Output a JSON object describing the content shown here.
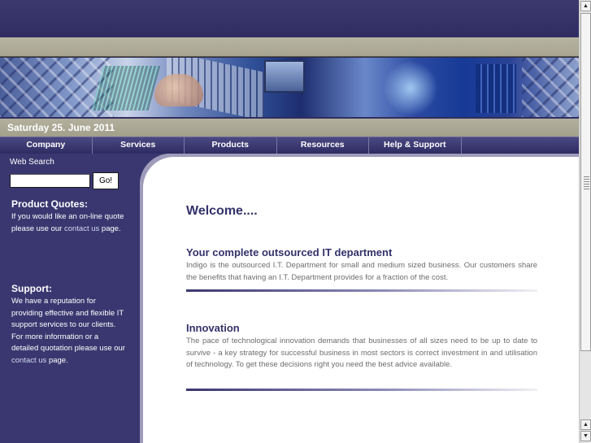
{
  "header": {
    "date": "Saturday 25. June 2011"
  },
  "nav": {
    "items": [
      "Company",
      "Services",
      "Products",
      "Resources",
      "Help & Support"
    ]
  },
  "sidebar": {
    "search_label": "Web Search",
    "search_value": "",
    "go_label": "Go!",
    "quotes": {
      "title": "Product Quotes:",
      "text_before": "If you would like an on-line quote please use our ",
      "link": "contact us",
      "text_after": " page."
    },
    "support": {
      "title": "Support:",
      "text_before": "We have a reputation for providing effective and flexible IT support services to our clients. For more information or a detailed quotation please use our ",
      "link": "contact us",
      "text_after": " page."
    }
  },
  "main": {
    "welcome": "Welcome....",
    "sections": [
      {
        "title": "Your complete outsourced IT department",
        "body": "Indigo is the outsourced I.T. Department for small and medium sized business. Our customers share the benefits that having an I.T. Department provides for a fraction of the cost."
      },
      {
        "title": "Innovation",
        "body": "The pace of technological innovation demands that businesses of all sizes need to be up to date to survive - a key strategy for successful business in most sectors is correct investment in and utilisation of technology. To get these decisions right you need the best advice available."
      }
    ]
  },
  "scrollbar": {
    "up_icon": "up-arrow-icon",
    "down_icon": "down-arrow-icon"
  }
}
